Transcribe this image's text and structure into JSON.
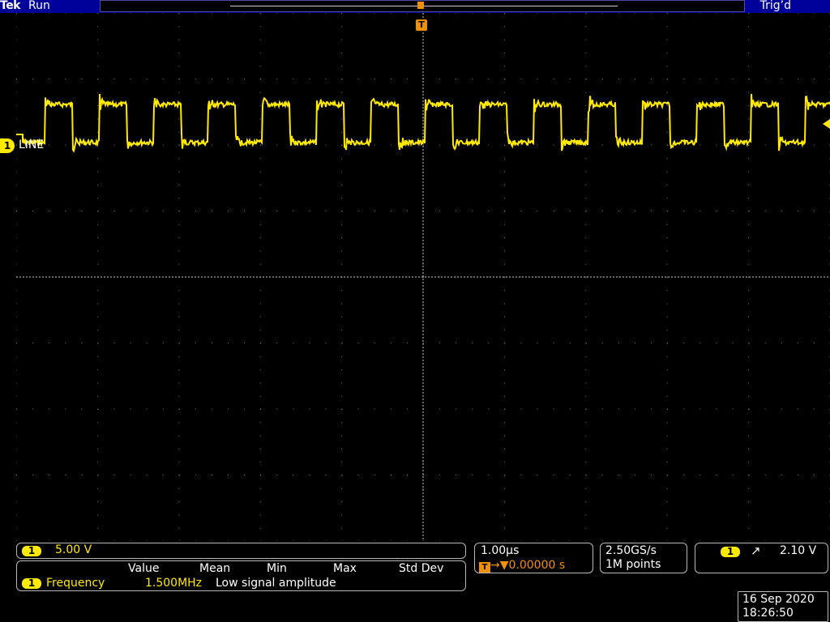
{
  "header": {
    "brand": "Tek",
    "run_status": "Run",
    "trigger_status": "Trig’d"
  },
  "markers": {
    "trigger_position": "T",
    "ch1_ground_badge": "1",
    "ch1_label": "LINE"
  },
  "channel1": {
    "badge": "1",
    "scale": "5.00 V",
    "color": "#ffea00"
  },
  "measurement": {
    "headers": [
      "Value",
      "Mean",
      "Min",
      "Max",
      "Std Dev"
    ],
    "badge": "1",
    "name": "Frequency",
    "value": "1.500MHz",
    "status": "Low signal amplitude"
  },
  "horizontal": {
    "timebase": "1.00µs",
    "trigger_icon": "T",
    "trigger_position": "→▼0.00000 s"
  },
  "acquisition": {
    "sample_rate": "2.50GS/s",
    "record_length": "1M points"
  },
  "trigger": {
    "badge": "1",
    "slope_icon": "rising-edge-icon",
    "slope_glyph": "↗",
    "level": "2.10 V"
  },
  "datetime": {
    "date": "16 Sep  2020",
    "time": "18:26:50"
  },
  "colors": {
    "accent_blue": "#00009a",
    "trace_yellow": "#ffea00",
    "trigger_orange": "#f29000"
  }
}
